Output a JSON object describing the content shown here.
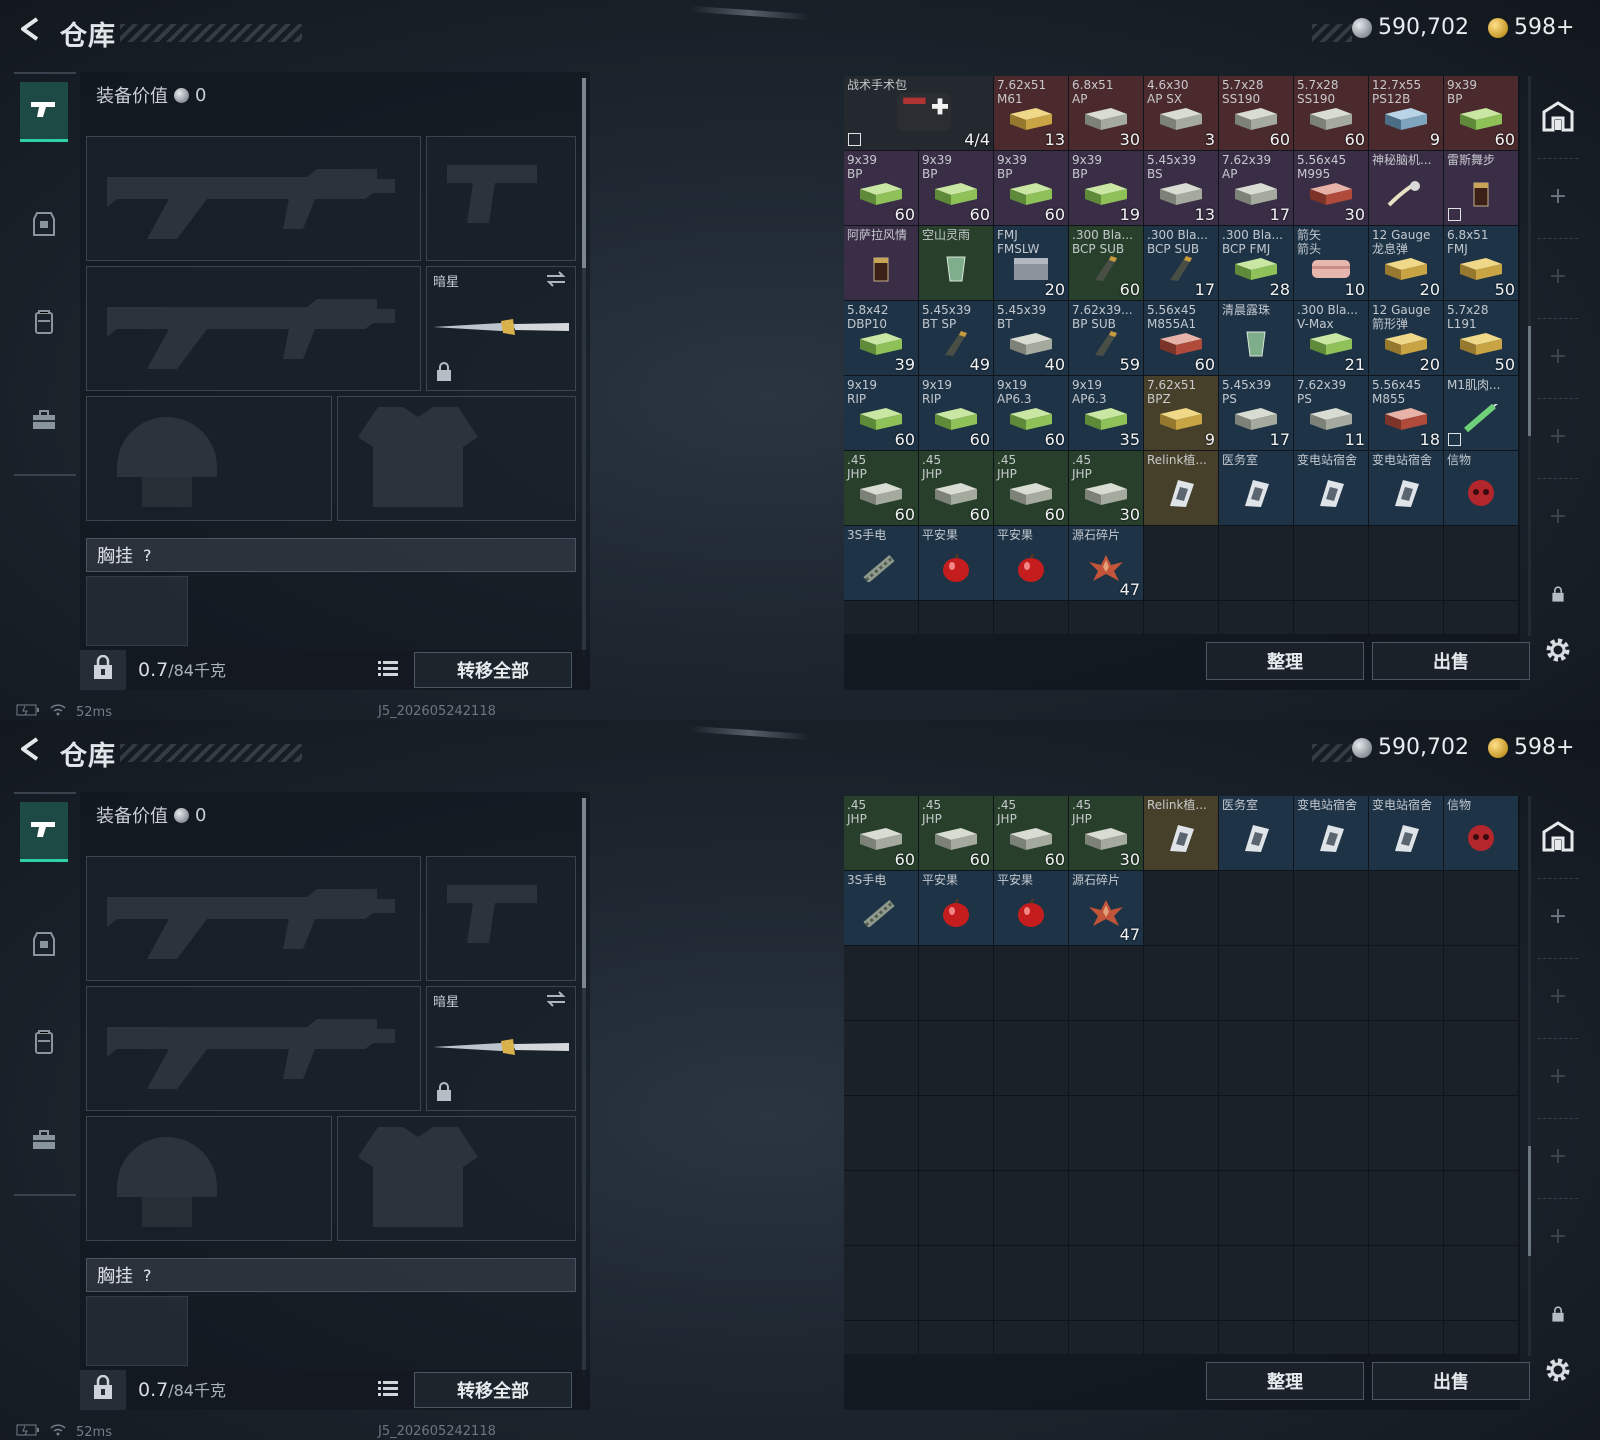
{
  "screens": [
    {
      "header": {
        "title": "仓库",
        "silver": "590,702",
        "gold": "598+"
      },
      "equipment": {
        "value_label": "装备价值",
        "value": "0",
        "melee_name": "暗星",
        "chest_label": "胸挂",
        "chest_help": "?",
        "weight": "0.7",
        "weight_unit": "/84千克",
        "transfer_all": "转移全部"
      },
      "status": {
        "ping": "52ms",
        "build": "J5_202605242118"
      },
      "stash_actions": {
        "sort": "整理",
        "sell": "出售"
      },
      "items": [
        {
          "name": "战术手术包",
          "count": "4/4",
          "color": "n",
          "art": "medkit",
          "wide": true,
          "tag": true
        },
        {
          "name": "7.62x51\nM61",
          "count": "13",
          "color": "r",
          "art": "ammo-y"
        },
        {
          "name": "6.8x51\nAP",
          "count": "30",
          "color": "r",
          "art": "ammo"
        },
        {
          "name": "4.6x30\nAP SX",
          "count": "3",
          "color": "r",
          "art": "ammo"
        },
        {
          "name": "5.7x28\nSS190",
          "count": "60",
          "color": "r",
          "art": "ammo"
        },
        {
          "name": "5.7x28\nSS190",
          "count": "60",
          "color": "r",
          "art": "ammo"
        },
        {
          "name": "12.7x55\nPS12B",
          "count": "9",
          "color": "r",
          "art": "ammo-b"
        },
        {
          "name": "9x39\nBP",
          "count": "60",
          "color": "r",
          "art": "ammo-g"
        },
        {
          "name": "9x39\nBP",
          "count": "60",
          "color": "p",
          "art": "ammo-g"
        },
        {
          "name": "9x39\nBP",
          "count": "60",
          "color": "p",
          "art": "ammo-g"
        },
        {
          "name": "9x39\nBP",
          "count": "60",
          "color": "p",
          "art": "ammo-g"
        },
        {
          "name": "9x39\nBP",
          "count": "19",
          "color": "p",
          "art": "ammo-g"
        },
        {
          "name": "5.45x39\nBS",
          "count": "13",
          "color": "p",
          "art": "ammo"
        },
        {
          "name": "7.62x39\nAP",
          "count": "17",
          "color": "p",
          "art": "ammo"
        },
        {
          "name": "5.56x45\nM995",
          "count": "30",
          "color": "p",
          "art": "ammo-r"
        },
        {
          "name": "神秘脑机...",
          "count": "",
          "color": "p",
          "art": "watch"
        },
        {
          "name": "雷斯舞步",
          "count": "",
          "color": "p",
          "art": "drink",
          "tag": true
        },
        {
          "name": "阿萨拉风情",
          "count": "",
          "color": "p",
          "art": "drink"
        },
        {
          "name": "空山灵雨",
          "count": "",
          "color": "g",
          "art": "glass"
        },
        {
          "name": "FMJ\nFMSLW",
          "count": "20",
          "color": "b",
          "art": "box"
        },
        {
          "name": ".300 Bla...\nBCP SUB",
          "count": "60",
          "color": "g",
          "art": "mag"
        },
        {
          "name": ".300 Bla...\nBCP SUB",
          "count": "17",
          "color": "b",
          "art": "mag"
        },
        {
          "name": ".300 Bla...\nBCP FMJ",
          "count": "28",
          "color": "b",
          "art": "ammo-g"
        },
        {
          "name": "箭矢\n箭头",
          "count": "10",
          "color": "b",
          "art": "case"
        },
        {
          "name": "12 Gauge\n龙息弹",
          "count": "20",
          "color": "b",
          "art": "ammo-y"
        },
        {
          "name": "6.8x51\nFMJ",
          "count": "50",
          "color": "b",
          "art": "ammo-y"
        },
        {
          "name": "5.8x42\nDBP10",
          "count": "39",
          "color": "b",
          "art": "ammo-g"
        },
        {
          "name": "5.45x39\nBT SP",
          "count": "49",
          "color": "b",
          "art": "mag"
        },
        {
          "name": "5.45x39\nBT",
          "count": "40",
          "color": "b",
          "art": "ammo"
        },
        {
          "name": "7.62x39...\nBP SUB",
          "count": "59",
          "color": "b",
          "art": "mag"
        },
        {
          "name": "5.56x45\nM855A1",
          "count": "60",
          "color": "b",
          "art": "ammo-r"
        },
        {
          "name": "清晨露珠",
          "count": "",
          "color": "b",
          "art": "glass"
        },
        {
          "name": ".300 Bla...\nV-Max",
          "count": "21",
          "color": "b",
          "art": "ammo-g"
        },
        {
          "name": "12 Gauge\n箭形弹",
          "count": "20",
          "color": "b",
          "art": "ammo-y"
        },
        {
          "name": "5.7x28\nL191",
          "count": "50",
          "color": "b",
          "art": "ammo-y"
        },
        {
          "name": "9x19\nRIP",
          "count": "60",
          "color": "b",
          "art": "ammo-g"
        },
        {
          "name": "9x19\nRIP",
          "count": "60",
          "color": "b",
          "art": "ammo-g"
        },
        {
          "name": "9x19\nAP6.3",
          "count": "60",
          "color": "b",
          "art": "ammo-g"
        },
        {
          "name": "9x19\nAP6.3",
          "count": "35",
          "color": "b",
          "art": "ammo-g"
        },
        {
          "name": "7.62x51\nBPZ",
          "count": "9",
          "color": "y",
          "art": "ammo-y"
        },
        {
          "name": "5.45x39\nPS",
          "count": "17",
          "color": "b",
          "art": "ammo"
        },
        {
          "name": "7.62x39\nPS",
          "count": "11",
          "color": "b",
          "art": "ammo"
        },
        {
          "name": "5.56x45\nM855",
          "count": "18",
          "color": "b",
          "art": "ammo-r"
        },
        {
          "name": "M1肌肉...",
          "count": "",
          "color": "b",
          "art": "syringe",
          "tag": true
        },
        {
          "name": ".45\nJHP",
          "count": "60",
          "color": "g",
          "art": "ammo"
        },
        {
          "name": ".45\nJHP",
          "count": "60",
          "color": "g",
          "art": "ammo"
        },
        {
          "name": ".45\nJHP",
          "count": "60",
          "color": "g",
          "art": "ammo"
        },
        {
          "name": ".45\nJHP",
          "count": "30",
          "color": "g",
          "art": "ammo"
        },
        {
          "name": "Relink植...",
          "count": "",
          "color": "y",
          "art": "card"
        },
        {
          "name": "医务室",
          "count": "",
          "color": "b",
          "art": "card"
        },
        {
          "name": "变电站宿舍",
          "count": "",
          "color": "b",
          "art": "card"
        },
        {
          "name": "变电站宿舍",
          "count": "",
          "color": "b",
          "art": "card"
        },
        {
          "name": "信物",
          "count": "",
          "color": "b",
          "art": "skull"
        },
        {
          "name": "3S手电",
          "count": "",
          "color": "b",
          "art": "torch"
        },
        {
          "name": "平安果",
          "count": "",
          "color": "b",
          "art": "apple"
        },
        {
          "name": "平安果",
          "count": "",
          "color": "b",
          "art": "apple"
        },
        {
          "name": "源石碎片",
          "count": "47",
          "color": "b",
          "art": "shard"
        }
      ]
    },
    {
      "header": {
        "title": "仓库",
        "silver": "590,702",
        "gold": "598+"
      },
      "equipment": {
        "value_label": "装备价值",
        "value": "0",
        "melee_name": "暗星",
        "chest_label": "胸挂",
        "chest_help": "?",
        "weight": "0.7",
        "weight_unit": "/84千克",
        "transfer_all": "转移全部"
      },
      "status": {
        "ping": "52ms",
        "build": "J5_202605242118"
      },
      "stash_actions": {
        "sort": "整理",
        "sell": "出售"
      },
      "items": [
        {
          "name": ".45\nJHP",
          "count": "60",
          "color": "g",
          "art": "ammo"
        },
        {
          "name": ".45\nJHP",
          "count": "60",
          "color": "g",
          "art": "ammo"
        },
        {
          "name": ".45\nJHP",
          "count": "60",
          "color": "g",
          "art": "ammo"
        },
        {
          "name": ".45\nJHP",
          "count": "30",
          "color": "g",
          "art": "ammo"
        },
        {
          "name": "Relink植...",
          "count": "",
          "color": "y",
          "art": "card"
        },
        {
          "name": "医务室",
          "count": "",
          "color": "b",
          "art": "card"
        },
        {
          "name": "变电站宿舍",
          "count": "",
          "color": "b",
          "art": "card"
        },
        {
          "name": "变电站宿舍",
          "count": "",
          "color": "b",
          "art": "card"
        },
        {
          "name": "信物",
          "count": "",
          "color": "b",
          "art": "skull"
        },
        {
          "name": "3S手电",
          "count": "",
          "color": "b",
          "art": "torch"
        },
        {
          "name": "平安果",
          "count": "",
          "color": "b",
          "art": "apple"
        },
        {
          "name": "平安果",
          "count": "",
          "color": "b",
          "art": "apple"
        },
        {
          "name": "源石碎片",
          "count": "47",
          "color": "b",
          "art": "shard"
        }
      ]
    }
  ]
}
